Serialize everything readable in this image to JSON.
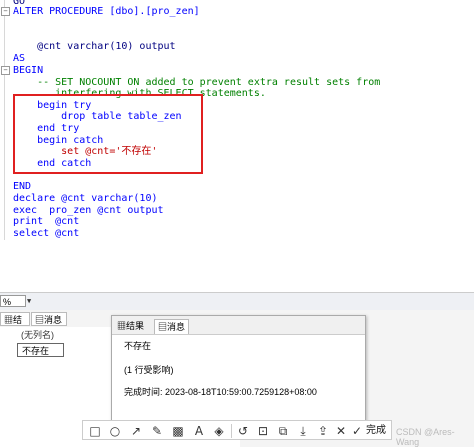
{
  "editor": {
    "lines": [
      {
        "text": "GO"
      },
      {
        "text": "ALTER PROCEDURE [dbo].[pro_zen]"
      },
      {
        "text": ""
      },
      {
        "text": ""
      },
      {
        "text": "    @cnt varchar(10) output"
      },
      {
        "text": "AS"
      },
      {
        "text": "BEGIN"
      },
      {
        "text": "    -- SET NOCOUNT ON added to prevent extra result sets from"
      },
      {
        "text": "       interfering with SELECT statements."
      },
      {
        "text": "    begin try"
      },
      {
        "text": "        drop table table_zen"
      },
      {
        "text": "    end try"
      },
      {
        "text": "    begin catch"
      },
      {
        "text": "        set @cnt='不存在'"
      },
      {
        "text": "    end catch"
      },
      {
        "text": ""
      },
      {
        "text": "END"
      },
      {
        "text": "declare @cnt varchar(10)"
      },
      {
        "text": "exec  pro_zen @cnt output"
      },
      {
        "text": "print  @cnt"
      },
      {
        "text": "select @cnt"
      }
    ]
  },
  "status": {
    "zoom": "%"
  },
  "results": {
    "tab_results": "结果",
    "tab_messages": "消息",
    "column_header": "(无列名)",
    "cell_value": "不存在"
  },
  "popup": {
    "tab_results": "结果",
    "tab_messages": "消息",
    "message": "不存在",
    "rows_affected": "(1 行受影响)",
    "completion": "完成时间: 2023-08-18T10:59:00.7259128+08:00"
  },
  "toolbar": {
    "done_label": "完成"
  },
  "watermark": "CSDN @Ares-Wang"
}
